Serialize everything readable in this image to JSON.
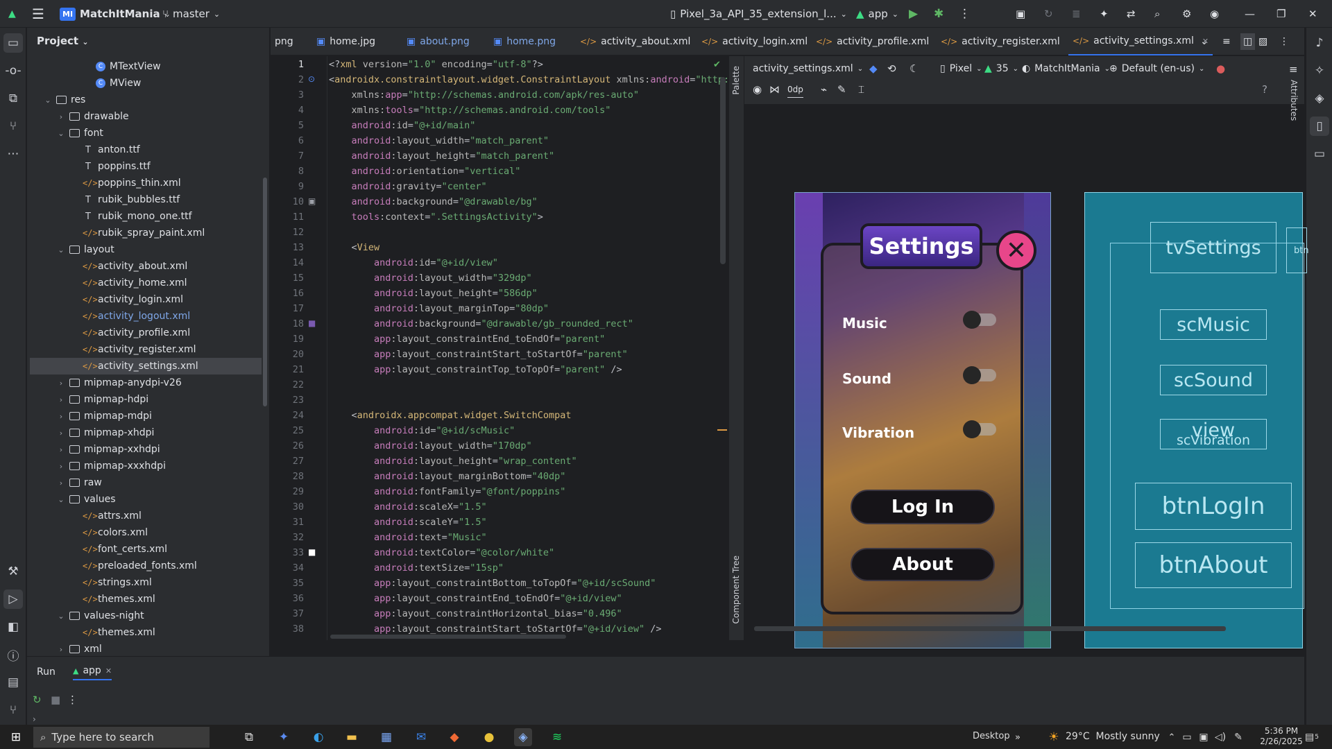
{
  "titlebar": {
    "project": "MatchItMania",
    "project_badge": "MI",
    "branch": "master",
    "device": "Pixel_3a_API_35_extension_l...",
    "module": "app"
  },
  "project_panel": {
    "title": "Project"
  },
  "tree": [
    {
      "label": "MTextView",
      "kind": "kotlin",
      "indent": 7
    },
    {
      "label": "MView",
      "kind": "kotlin",
      "indent": 7
    },
    {
      "label": "res",
      "kind": "folder",
      "indent": 4,
      "arrow": "v"
    },
    {
      "label": "drawable",
      "kind": "folder",
      "indent": 5,
      "arrow": ">"
    },
    {
      "label": "font",
      "kind": "folder",
      "indent": 5,
      "arrow": "v"
    },
    {
      "label": "anton.ttf",
      "kind": "font",
      "indent": 6
    },
    {
      "label": "poppins.ttf",
      "kind": "font",
      "indent": 6
    },
    {
      "label": "poppins_thin.xml",
      "kind": "xml",
      "indent": 6
    },
    {
      "label": "rubik_bubbles.ttf",
      "kind": "font",
      "indent": 6
    },
    {
      "label": "rubik_mono_one.ttf",
      "kind": "font",
      "indent": 6
    },
    {
      "label": "rubik_spray_paint.xml",
      "kind": "xml",
      "indent": 6
    },
    {
      "label": "layout",
      "kind": "folder",
      "indent": 5,
      "arrow": "v"
    },
    {
      "label": "activity_about.xml",
      "kind": "xml",
      "indent": 6
    },
    {
      "label": "activity_home.xml",
      "kind": "xml",
      "indent": 6
    },
    {
      "label": "activity_login.xml",
      "kind": "xml",
      "indent": 6
    },
    {
      "label": "activity_logout.xml",
      "kind": "xml",
      "indent": 6,
      "dim": true
    },
    {
      "label": "activity_profile.xml",
      "kind": "xml",
      "indent": 6
    },
    {
      "label": "activity_register.xml",
      "kind": "xml",
      "indent": 6
    },
    {
      "label": "activity_settings.xml",
      "kind": "xml",
      "indent": 6,
      "selected": true
    },
    {
      "label": "mipmap-anydpi-v26",
      "kind": "folder",
      "indent": 5,
      "arrow": ">"
    },
    {
      "label": "mipmap-hdpi",
      "kind": "folder",
      "indent": 5,
      "arrow": ">"
    },
    {
      "label": "mipmap-mdpi",
      "kind": "folder",
      "indent": 5,
      "arrow": ">"
    },
    {
      "label": "mipmap-xhdpi",
      "kind": "folder",
      "indent": 5,
      "arrow": ">"
    },
    {
      "label": "mipmap-xxhdpi",
      "kind": "folder",
      "indent": 5,
      "arrow": ">"
    },
    {
      "label": "mipmap-xxxhdpi",
      "kind": "folder",
      "indent": 5,
      "arrow": ">"
    },
    {
      "label": "raw",
      "kind": "folder",
      "indent": 5,
      "arrow": ">"
    },
    {
      "label": "values",
      "kind": "folder",
      "indent": 5,
      "arrow": "v"
    },
    {
      "label": "attrs.xml",
      "kind": "xml",
      "indent": 6
    },
    {
      "label": "colors.xml",
      "kind": "xml",
      "indent": 6
    },
    {
      "label": "font_certs.xml",
      "kind": "xml",
      "indent": 6
    },
    {
      "label": "preloaded_fonts.xml",
      "kind": "xml",
      "indent": 6
    },
    {
      "label": "strings.xml",
      "kind": "xml",
      "indent": 6
    },
    {
      "label": "themes.xml",
      "kind": "xml",
      "indent": 6
    },
    {
      "label": "values-night",
      "kind": "folder",
      "indent": 5,
      "arrow": "v"
    },
    {
      "label": "themes.xml",
      "kind": "xml",
      "indent": 6
    },
    {
      "label": "xml",
      "kind": "folder",
      "indent": 5,
      "arrow": ">"
    }
  ],
  "tabs": [
    {
      "label": "png",
      "kind": "none"
    },
    {
      "label": "home.jpg",
      "kind": "img"
    },
    {
      "label": "about.png",
      "kind": "img",
      "dim": true
    },
    {
      "label": "home.png",
      "kind": "img",
      "dim": true
    },
    {
      "label": "activity_about.xml",
      "kind": "xml"
    },
    {
      "label": "activity_login.xml",
      "kind": "xml"
    },
    {
      "label": "activity_profile.xml",
      "kind": "xml"
    },
    {
      "label": "activity_register.xml",
      "kind": "xml"
    },
    {
      "label": "activity_settings.xml",
      "kind": "xml",
      "active": true
    }
  ],
  "code": [
    [
      [
        "pun",
        "<?"
      ],
      [
        "tag",
        "xml "
      ],
      [
        "attr",
        "version"
      ],
      [
        "pun",
        "="
      ],
      [
        "str",
        "\"1.0\""
      ],
      [
        "attr",
        " encoding"
      ],
      [
        "pun",
        "="
      ],
      [
        "str",
        "\"utf-8\""
      ],
      [
        "pun",
        "?>"
      ]
    ],
    [
      [
        "pun",
        "<"
      ],
      [
        "tag",
        "androidx.constraintlayout.widget.ConstraintLayout "
      ],
      [
        "attr",
        "xmlns:"
      ],
      [
        "ns",
        "android"
      ],
      [
        "pun",
        "="
      ],
      [
        "str",
        "\"http:/"
      ]
    ],
    [
      [
        "attr",
        "    xmlns:"
      ],
      [
        "ns",
        "app"
      ],
      [
        "pun",
        "="
      ],
      [
        "str",
        "\"http://schemas.android.com/apk/res-auto\""
      ]
    ],
    [
      [
        "attr",
        "    xmlns:"
      ],
      [
        "ns",
        "tools"
      ],
      [
        "pun",
        "="
      ],
      [
        "str",
        "\"http://schemas.android.com/tools\""
      ]
    ],
    [
      [
        "ns",
        "    android"
      ],
      [
        "attr",
        ":id"
      ],
      [
        "pun",
        "="
      ],
      [
        "str",
        "\"@+id/main\""
      ]
    ],
    [
      [
        "ns",
        "    android"
      ],
      [
        "attr",
        ":layout_width"
      ],
      [
        "pun",
        "="
      ],
      [
        "str",
        "\"match_parent\""
      ]
    ],
    [
      [
        "ns",
        "    android"
      ],
      [
        "attr",
        ":layout_height"
      ],
      [
        "pun",
        "="
      ],
      [
        "str",
        "\"match_parent\""
      ]
    ],
    [
      [
        "ns",
        "    android"
      ],
      [
        "attr",
        ":orientation"
      ],
      [
        "pun",
        "="
      ],
      [
        "str",
        "\"vertical\""
      ]
    ],
    [
      [
        "ns",
        "    android"
      ],
      [
        "attr",
        ":gravity"
      ],
      [
        "pun",
        "="
      ],
      [
        "str",
        "\"center\""
      ]
    ],
    [
      [
        "ns",
        "    android"
      ],
      [
        "attr",
        ":background"
      ],
      [
        "pun",
        "="
      ],
      [
        "str",
        "\"@drawable/bg\""
      ]
    ],
    [
      [
        "ns",
        "    tools"
      ],
      [
        "attr",
        ":context"
      ],
      [
        "pun",
        "="
      ],
      [
        "str",
        "\".SettingsActivity\""
      ],
      [
        "pun",
        ">"
      ]
    ],
    [],
    [
      [
        "pun",
        "    <"
      ],
      [
        "tag",
        "View"
      ]
    ],
    [
      [
        "ns",
        "        android"
      ],
      [
        "attr",
        ":id"
      ],
      [
        "pun",
        "="
      ],
      [
        "str",
        "\"@+id/view\""
      ]
    ],
    [
      [
        "ns",
        "        android"
      ],
      [
        "attr",
        ":layout_width"
      ],
      [
        "pun",
        "="
      ],
      [
        "str",
        "\"329dp\""
      ]
    ],
    [
      [
        "ns",
        "        android"
      ],
      [
        "attr",
        ":layout_height"
      ],
      [
        "pun",
        "="
      ],
      [
        "str",
        "\"586dp\""
      ]
    ],
    [
      [
        "ns",
        "        android"
      ],
      [
        "attr",
        ":layout_marginTop"
      ],
      [
        "pun",
        "="
      ],
      [
        "str",
        "\"80dp\""
      ]
    ],
    [
      [
        "ns",
        "        android"
      ],
      [
        "attr",
        ":background"
      ],
      [
        "pun",
        "="
      ],
      [
        "str",
        "\"@drawable/gb_rounded_rect\""
      ]
    ],
    [
      [
        "ns",
        "        app"
      ],
      [
        "attr",
        ":layout_constraintEnd_toEndOf"
      ],
      [
        "pun",
        "="
      ],
      [
        "str",
        "\"parent\""
      ]
    ],
    [
      [
        "ns",
        "        app"
      ],
      [
        "attr",
        ":layout_constraintStart_toStartOf"
      ],
      [
        "pun",
        "="
      ],
      [
        "str",
        "\"parent\""
      ]
    ],
    [
      [
        "ns",
        "        app"
      ],
      [
        "attr",
        ":layout_constraintTop_toTopOf"
      ],
      [
        "pun",
        "="
      ],
      [
        "str",
        "\"parent\""
      ],
      [
        "pun",
        " />"
      ]
    ],
    [],
    [],
    [
      [
        "pun",
        "    <"
      ],
      [
        "tag",
        "androidx.appcompat.widget.SwitchCompat"
      ]
    ],
    [
      [
        "ns",
        "        android"
      ],
      [
        "attr",
        ":id"
      ],
      [
        "pun",
        "="
      ],
      [
        "str",
        "\"@+id/scMusic\""
      ]
    ],
    [
      [
        "ns",
        "        android"
      ],
      [
        "attr",
        ":layout_width"
      ],
      [
        "pun",
        "="
      ],
      [
        "str",
        "\"170dp\""
      ]
    ],
    [
      [
        "ns",
        "        android"
      ],
      [
        "attr",
        ":layout_height"
      ],
      [
        "pun",
        "="
      ],
      [
        "str",
        "\"wrap_content\""
      ]
    ],
    [
      [
        "ns",
        "        android"
      ],
      [
        "attr",
        ":layout_marginBottom"
      ],
      [
        "pun",
        "="
      ],
      [
        "str",
        "\"40dp\""
      ]
    ],
    [
      [
        "ns",
        "        android"
      ],
      [
        "attr",
        ":fontFamily"
      ],
      [
        "pun",
        "="
      ],
      [
        "str",
        "\"@font/poppins\""
      ]
    ],
    [
      [
        "ns",
        "        android"
      ],
      [
        "attr",
        ":scaleX"
      ],
      [
        "pun",
        "="
      ],
      [
        "str",
        "\"1.5\""
      ]
    ],
    [
      [
        "ns",
        "        android"
      ],
      [
        "attr",
        ":scaleY"
      ],
      [
        "pun",
        "="
      ],
      [
        "str",
        "\"1.5\""
      ]
    ],
    [
      [
        "ns",
        "        android"
      ],
      [
        "attr",
        ":text"
      ],
      [
        "pun",
        "="
      ],
      [
        "str",
        "\"Music\""
      ]
    ],
    [
      [
        "ns",
        "        android"
      ],
      [
        "attr",
        ":textColor"
      ],
      [
        "pun",
        "="
      ],
      [
        "str",
        "\"@color/white\""
      ]
    ],
    [
      [
        "ns",
        "        android"
      ],
      [
        "attr",
        ":textSize"
      ],
      [
        "pun",
        "="
      ],
      [
        "str",
        "\"15sp\""
      ]
    ],
    [
      [
        "ns",
        "        app"
      ],
      [
        "attr",
        ":layout_constraintBottom_toTopOf"
      ],
      [
        "pun",
        "="
      ],
      [
        "str",
        "\"@+id/scSound\""
      ]
    ],
    [
      [
        "ns",
        "        app"
      ],
      [
        "attr",
        ":layout_constraintEnd_toEndOf"
      ],
      [
        "pun",
        "="
      ],
      [
        "str",
        "\"@+id/view\""
      ]
    ],
    [
      [
        "ns",
        "        app"
      ],
      [
        "attr",
        ":layout_constraintHorizontal_bias"
      ],
      [
        "pun",
        "="
      ],
      [
        "str",
        "\"0.496\""
      ]
    ],
    [
      [
        "ns",
        "        app"
      ],
      [
        "attr",
        ":layout_constraintStart_toStartOf"
      ],
      [
        "pun",
        "="
      ],
      [
        "str",
        "\"@+id/view\""
      ],
      [
        "pun",
        " />"
      ]
    ]
  ],
  "design_toolbar": {
    "file": "activity_settings.xml",
    "device": "Pixel",
    "api": "35",
    "theme": "MatchItMania",
    "locale": "Default (en-us)",
    "margin": "0dp",
    "palette": "Palette",
    "component_tree": "Component Tree",
    "attributes": "Attributes"
  },
  "phone": {
    "title": "Settings",
    "music": "Music",
    "sound": "Sound",
    "vibration": "Vibration",
    "login": "Log In",
    "about": "About"
  },
  "blueprint": {
    "tvSettings": "tvSettings",
    "btn_peek": "btn",
    "scMusic": "scMusic",
    "scSound": "scSound",
    "view": "view",
    "scVibration": "scVibration",
    "btnLogIn": "btnLogIn",
    "btnAbout": "btnAbout"
  },
  "run": {
    "title": "Run",
    "config": "app"
  },
  "taskbar": {
    "search_placeholder": "Type here to search",
    "desktop": "Desktop",
    "weather": "29°C  Mostly sunny",
    "time": "5:36 PM",
    "date": "2/26/2025",
    "notif": "5"
  },
  "colors": {
    "accent": "#3574f0",
    "blueprint": "#1b7a91",
    "ok": "#5fb865",
    "error": "#db5c5c"
  }
}
